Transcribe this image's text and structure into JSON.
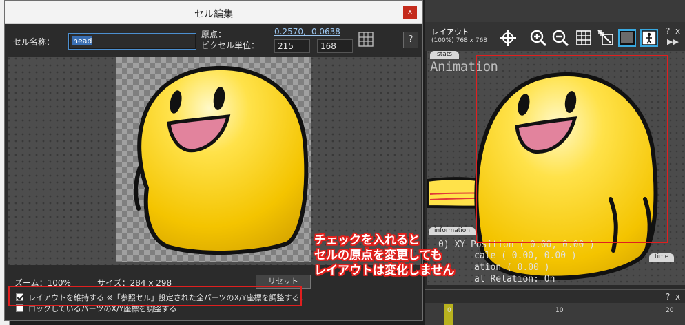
{
  "dialog": {
    "title": "セル編集",
    "close": "x",
    "name_label": "セル名称：",
    "name_value": "head",
    "origin_label": "原点：",
    "origin_value": "0.2570, -0.0638",
    "pixel_label": "ピクセル単位：",
    "pixel_x": "215",
    "pixel_y": "168",
    "help": "?",
    "zoom_label": "ズーム：100%",
    "size_label": "サイズ：284 x 298",
    "reset_label": "リセット",
    "check1_label": "レイアウトを維持する ※「参照セル」設定された全パーツのX/Y座標を調整する。",
    "check1_checked": true,
    "check2_label": "ロックしているパーツのX/Y座標を調整する",
    "check2_checked": false
  },
  "layout_panel": {
    "title": "レイアウト",
    "subtitle": "(100%) 768 x 768",
    "help": "?",
    "close": "x",
    "stats_tab": "stats",
    "anim_label": "Animation",
    "info_tab": "information",
    "time_tab": "time",
    "info_lines": [
      "0) XY Position ( 0.00, 0.00 )",
      "cale ( 0.00, 0.00 )",
      "ation ( 0.00 )",
      "al Relation: On"
    ],
    "timeline_ticks": [
      "0",
      "10",
      "20"
    ],
    "timeline_help": "?",
    "timeline_close": "x"
  },
  "annotation": {
    "line1": "チェックを入れると",
    "line2": "セルの原点を変更しても",
    "line3": "レイアウトは変化しません"
  },
  "colors": {
    "highlight_red": "#e01f1f",
    "guide_yellow": "#c8c83c",
    "selected_tool": "#39a9e0"
  }
}
